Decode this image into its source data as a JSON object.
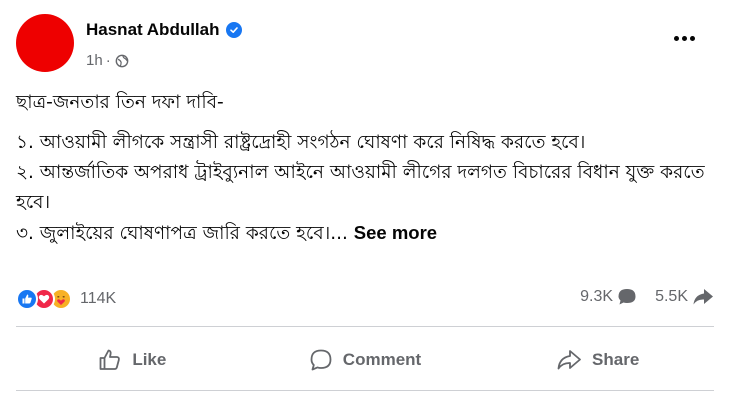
{
  "post": {
    "author": "Hasnat Abdullah",
    "time": "1h",
    "separator": "·",
    "content": {
      "line1": "ছাত্র-জনতার তিন দফা দাবি-",
      "point1": "১. আওয়ামী লীগকে সন্ত্রাসী রাষ্ট্রদ্রোহী সংগঠন ঘোষণা করে নিষিদ্ধ করতে হবে।",
      "point2": "২. আন্তর্জাতিক অপরাধ ট্রাইব্যুনাল আইনে আওয়ামী লীগের দলগত বিচারের বিধান যুক্ত করতে হবে।",
      "point3": "৩. জুলাইয়ের ঘোষণাপত্র জারি করতে হবে।...",
      "see_more": "See more"
    },
    "stats": {
      "reactions_count": "114K",
      "comments_count": "9.3K",
      "shares_count": "5.5K",
      "reaction_icons": [
        "like-icon",
        "love-icon",
        "care-icon"
      ]
    },
    "actions": {
      "like": "Like",
      "comment": "Comment",
      "share": "Share"
    }
  },
  "colors": {
    "avatar": "#ee0000",
    "brand_blue": "#1877f2",
    "secondary_text": "#65676b"
  }
}
